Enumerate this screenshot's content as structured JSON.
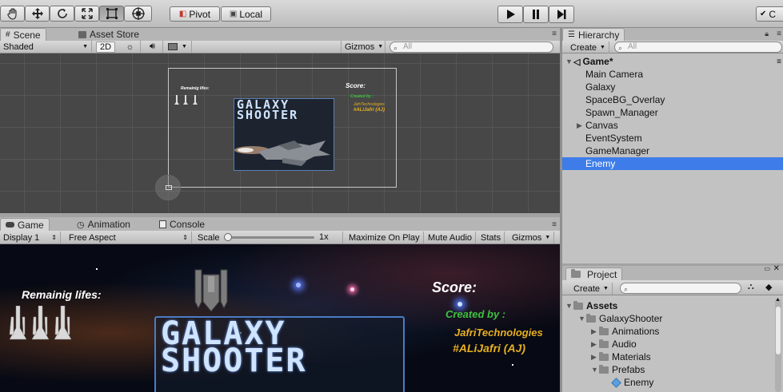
{
  "toolbar": {
    "pivot_label": "Pivot",
    "local_label": "Local",
    "right_label": "C"
  },
  "scene": {
    "tab_scene": "Scene",
    "tab_asset_store": "Asset Store",
    "shading_mode": "Shaded",
    "toggle_2d": "2D",
    "gizmos_label": "Gizmos",
    "search_placeholder": "All",
    "preview": {
      "lives_label": "Remainig lifes:",
      "score_label": "Score:",
      "created_by": "Created by :",
      "credit_company": "JafriTechnologies",
      "credit_author": "#ALiJafri (AJ)",
      "title_line1": "GALAXY",
      "title_line2": "SHOOTER"
    }
  },
  "game": {
    "tab_game": "Game",
    "tab_animation": "Animation",
    "tab_console": "Console",
    "display": "Display 1",
    "aspect": "Free Aspect",
    "scale_label": "Scale",
    "scale_value": "1x",
    "maximize_on_play": "Maximize On Play",
    "mute_audio": "Mute Audio",
    "stats": "Stats",
    "gizmos": "Gizmos",
    "view": {
      "lives_label": "Remainig lifes:",
      "score_label": "Score:",
      "created_by": "Created by :",
      "credit_company": "JafriTechnologies",
      "credit_author": "#ALiJafri (AJ)",
      "title_line1": "GALAXY",
      "title_line2": "SHOOTER"
    }
  },
  "hierarchy": {
    "tab": "Hierarchy",
    "create_label": "Create",
    "search_placeholder": "All",
    "scene_name": "Game*",
    "items": [
      {
        "label": "Main Camera"
      },
      {
        "label": "Galaxy"
      },
      {
        "label": "SpaceBG_Overlay"
      },
      {
        "label": "Spawn_Manager"
      },
      {
        "label": "Canvas"
      },
      {
        "label": "EventSystem"
      },
      {
        "label": "GameManager"
      },
      {
        "label": "Enemy"
      }
    ],
    "selected_color": "#3e7de9"
  },
  "project": {
    "tab": "Project",
    "create_label": "Create",
    "tree": [
      {
        "label": "Assets"
      },
      {
        "label": "GalaxyShooter"
      },
      {
        "label": "Animations"
      },
      {
        "label": "Audio"
      },
      {
        "label": "Materials"
      },
      {
        "label": "Prefabs"
      },
      {
        "label": "Enemy"
      }
    ]
  },
  "colors": {
    "scene_bg": "#474747",
    "credit_green": "#3ec33e",
    "credit_gold": "#e8b020",
    "title_blue": "#cfe4ff"
  }
}
